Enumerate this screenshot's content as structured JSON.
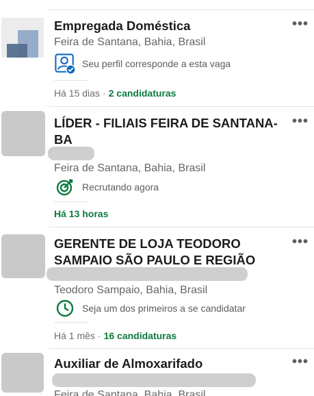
{
  "jobs": [
    {
      "title": "Empregada Doméstica",
      "location": "Feira de Santana, Bahia, Brasil",
      "insight": "Seu perfil corresponde a esta vaga",
      "posted": "Há 15 dias",
      "applicants": "2 candidaturas"
    },
    {
      "title": "LÍDER - FILIAIS FEIRA DE SANTANA-BA",
      "location": "Feira de Santana, Bahia, Brasil",
      "insight": "Recrutando agora",
      "posted": "Há 13 horas"
    },
    {
      "title": "GERENTE DE LOJA TEODORO SAMPAIO SÃO PAULO E REGIÃO",
      "location": "Teodoro Sampaio, Bahia, Brasil",
      "insight": "Seja um dos primeiros a se candidatar",
      "posted": "Há 1 mês",
      "applicants": "16 candidaturas"
    },
    {
      "title": "Auxiliar de Almoxarifado",
      "location": "Feira de Santana, Bahia, Brasil"
    }
  ],
  "menu_glyph": "•••",
  "separator": "·",
  "colors": {
    "accent_green": "#0c7a3e",
    "accent_blue": "#0a66c2",
    "redaction_gray": "#cfcfcf"
  },
  "icons": {
    "profile_match": "profile-match-icon",
    "recruiting": "target-icon",
    "early_applicant": "clock-icon",
    "menu": "more-options-icon"
  }
}
